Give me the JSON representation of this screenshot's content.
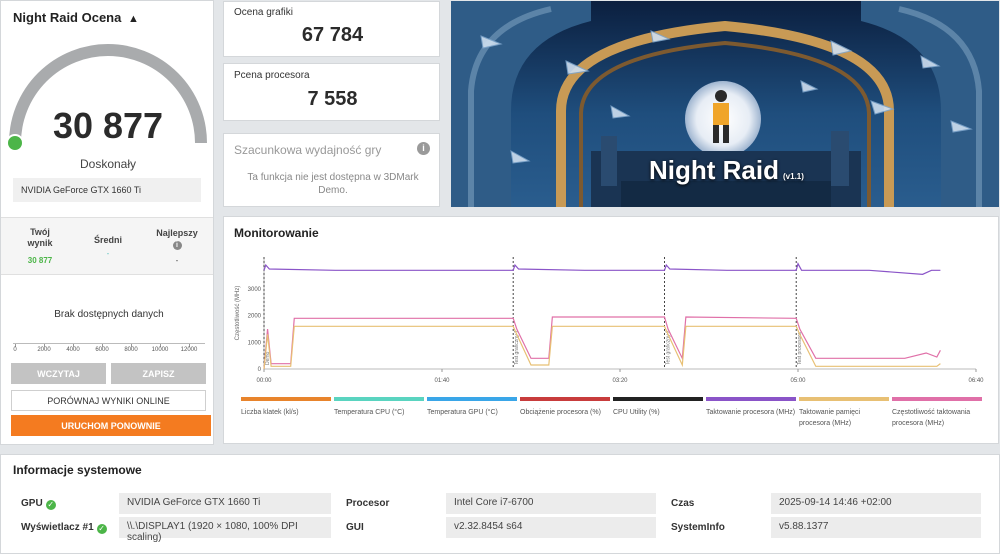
{
  "score_panel": {
    "title": "Night Raid Ocena",
    "score": "30 877",
    "rating": "Doskonały",
    "gpu": "NVIDIA GeForce GTX 1660 Ti",
    "gauge_fill": 0.97
  },
  "comparison": {
    "your_score_label": "Twój wynik",
    "your_score_value": "30 877",
    "average_label": "Średni",
    "average_value": "-",
    "best_label": "Najlepszy",
    "best_value": "-",
    "no_data": "Brak dostępnych danych",
    "axis_ticks": [
      "0",
      "2000",
      "4000",
      "6000",
      "8000",
      "10000",
      "12000"
    ]
  },
  "buttons": {
    "load": "WCZYTAJ",
    "save": "ZAPISZ",
    "compare_online": "PORÓWNAJ WYNIKI ONLINE",
    "run_again": "URUCHOM PONOWNIE"
  },
  "graphics_score": {
    "label": "Ocena grafiki",
    "value": "67 784"
  },
  "cpu_score": {
    "label": "Pcena procesora",
    "value": "7 558"
  },
  "estimated": {
    "title": "Szacunkowa wydajność gry",
    "message": "Ta funkcja nie jest dostępna w 3DMark Demo."
  },
  "hero": {
    "title": "Night Raid",
    "version": "(v1.1)"
  },
  "monitoring": {
    "title": "Monitorowanie",
    "ylabel": "Częstotliwość (MHz)",
    "y_ticks": [
      "3000",
      "2000",
      "1000",
      "0"
    ],
    "x_ticks": [
      "00:00",
      "01:40",
      "03:20",
      "05:00",
      "06:40"
    ],
    "markers": [
      "Demo",
      "Test graficzny 1",
      "Test graficzny 2",
      "Test procesora"
    ],
    "legend": [
      {
        "label": "Liczba klatek (kl/s)",
        "color": "#e8842c"
      },
      {
        "label": "Temperatura CPU (°C)",
        "color": "#5ad4c0"
      },
      {
        "label": "Temperatura GPU (°C)",
        "color": "#3aa6e8"
      },
      {
        "label": "Obciążenie procesora (%)",
        "color": "#c83c3c"
      },
      {
        "label": "CPU Utility (%)",
        "color": "#222222"
      },
      {
        "label": "Taktowanie procesora (MHz)",
        "color": "#8a54c8"
      },
      {
        "label": "Taktowanie pamięci procesora (MHz)",
        "color": "#e8c074"
      },
      {
        "label": "Częstotliwość taktowania procesora (MHz)",
        "color": "#e070a8"
      }
    ]
  },
  "chart_data": {
    "type": "line",
    "ylabel": "Częstotliwość (MHz)",
    "xlabel": "",
    "x_ticks": [
      "00:00",
      "01:40",
      "03:20",
      "05:00",
      "06:40"
    ],
    "ylim": [
      0,
      4200
    ],
    "xlim": [
      0,
      400
    ],
    "series": [
      {
        "name": "Taktowanie procesora (MHz)",
        "color": "#8a54c8",
        "x": [
          0,
          1,
          3,
          40,
          80,
          120,
          140,
          141,
          143,
          180,
          220,
          225,
          226,
          228,
          260,
          290,
          299,
          300,
          302,
          340,
          370,
          375,
          380
        ],
        "y": [
          3700,
          3900,
          3750,
          3700,
          3700,
          3700,
          3700,
          3900,
          3750,
          3700,
          3700,
          3700,
          3900,
          3750,
          3700,
          3700,
          3700,
          3950,
          3700,
          3700,
          3550,
          3700,
          3700
        ]
      },
      {
        "name": "Częstotliwość taktowania procesora (MHz)",
        "color": "#e070a8",
        "x": [
          0,
          2,
          4,
          15,
          17,
          140,
          142,
          150,
          160,
          162,
          225,
          227,
          235,
          237,
          299,
          301,
          310,
          360,
          372,
          378,
          380
        ],
        "y": [
          0,
          1500,
          200,
          200,
          1900,
          1900,
          1500,
          400,
          400,
          1950,
          1950,
          1500,
          400,
          1950,
          1900,
          1500,
          400,
          400,
          600,
          450,
          700
        ]
      },
      {
        "name": "Taktowanie pamięci procesora (MHz)",
        "color": "#e8c074",
        "x": [
          0,
          2,
          4,
          15,
          17,
          140,
          142,
          150,
          160,
          162,
          225,
          227,
          235,
          237,
          299,
          301,
          310,
          378,
          380
        ],
        "y": [
          0,
          1300,
          100,
          100,
          1600,
          1600,
          1300,
          150,
          150,
          1600,
          1600,
          1300,
          150,
          1600,
          1600,
          1300,
          100,
          100,
          200
        ]
      }
    ]
  },
  "system": {
    "title": "Informacje systemowe",
    "gpu_label": "GPU",
    "gpu_value": "NVIDIA GeForce GTX 1660 Ti",
    "display_label": "Wyświetlacz #1",
    "display_value": "\\\\.\\DISPLAY1 (1920 × 1080, 100% DPI scaling)",
    "cpu_label": "Procesor",
    "cpu_value": "Intel Core i7-6700",
    "gui_label": "GUI",
    "gui_value": "v2.32.8454 s64",
    "time_label": "Czas",
    "time_value": "2025-09-14 14:46 +02:00",
    "sysinfo_label": "SystemInfo",
    "sysinfo_value": "v5.88.1377"
  },
  "colors": {
    "accent_orange": "#f47b20",
    "ok_green": "#4cb548",
    "gauge_gray": "#a9abad"
  }
}
